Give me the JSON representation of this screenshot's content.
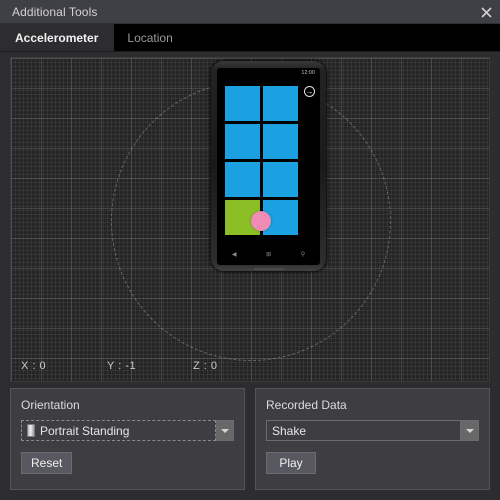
{
  "window": {
    "title": "Additional Tools",
    "close_icon": "close-icon"
  },
  "tabs": [
    {
      "label": "Accelerometer",
      "active": true
    },
    {
      "label": "Location",
      "active": false
    }
  ],
  "accelerometer": {
    "readout": {
      "x_label": "X : 0",
      "y_label": "Y : -1",
      "z_label": "Z : 0"
    },
    "phone": {
      "status_time": "12:00",
      "rotate_icon": "rotate-arrow-icon",
      "nav": {
        "back_icon": "◀",
        "home_icon": "⊞",
        "search_icon": "⚲"
      },
      "tiles": [
        {
          "color": "#1ba1e2"
        },
        {
          "color": "#1ba1e2"
        },
        {
          "color": "#1ba1e2"
        },
        {
          "color": "#1ba1e2"
        },
        {
          "color": "#1ba1e2"
        },
        {
          "color": "#1ba1e2"
        },
        {
          "color": "#8cbf26"
        },
        {
          "color": "#1ba1e2"
        }
      ]
    },
    "dot_color": "#f08cb4"
  },
  "orientation": {
    "title": "Orientation",
    "selected": "Portrait Standing",
    "icon": "phone-icon",
    "dropdown_icon": "chevron-down-icon",
    "reset_label": "Reset"
  },
  "recorded_data": {
    "title": "Recorded Data",
    "selected": "Shake",
    "dropdown_icon": "chevron-down-icon",
    "play_label": "Play"
  },
  "colors": {
    "tile_blue": "#1ba1e2",
    "tile_green": "#8cbf26",
    "dot_pink": "#f08cb4",
    "window_bg": "#2d2d30",
    "titlebar_bg": "#3f3f46",
    "group_bg": "#3e3e42"
  }
}
